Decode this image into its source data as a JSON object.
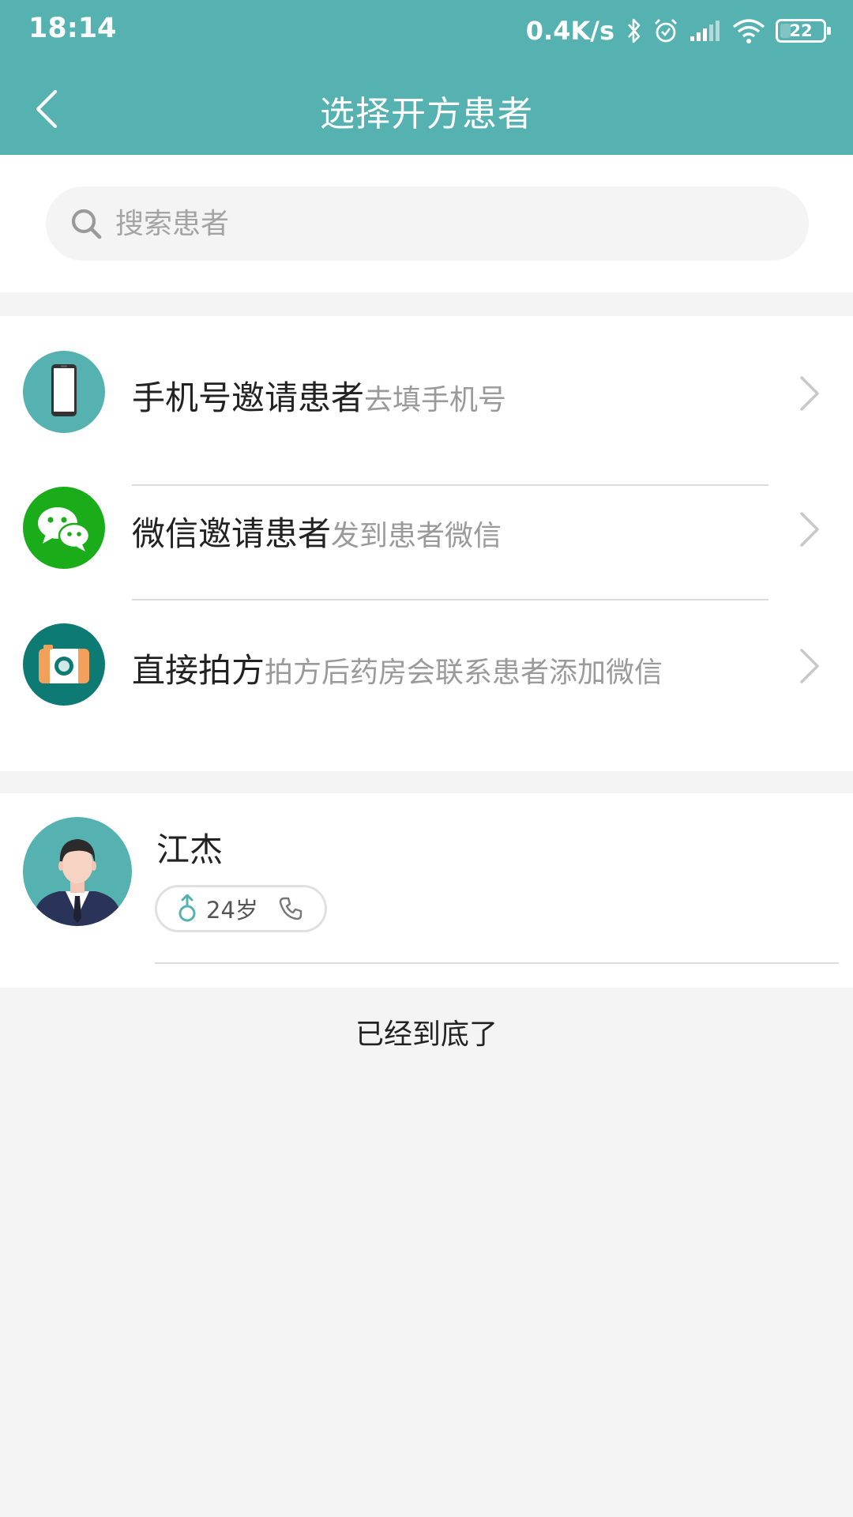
{
  "status_bar": {
    "time": "18:14",
    "network_speed": "0.4K/s",
    "battery_level": "22",
    "icons": [
      "bluetooth-icon",
      "alarm-icon",
      "signal-icon",
      "wifi-icon",
      "battery-icon"
    ]
  },
  "header": {
    "title": "选择开方患者",
    "background_color": "#56b2b1"
  },
  "search": {
    "placeholder": "搜索患者"
  },
  "invite_options": [
    {
      "label": "手机号邀请患者",
      "sub": "去填手机号",
      "icon": "phone-device-icon",
      "icon_color": "#56b2b1"
    },
    {
      "label": "微信邀请患者",
      "sub": "发到患者微信",
      "icon": "wechat-icon",
      "icon_color": "#1aad19"
    },
    {
      "label": "直接拍方",
      "sub": "拍方后药房会联系患者添加微信",
      "icon": "camera-icon",
      "icon_color": "#0e7a74"
    }
  ],
  "patients": [
    {
      "name": "江杰",
      "age": "24岁",
      "gender": "male",
      "icon": "male-gender-icon"
    }
  ],
  "footer": {
    "end_text": "已经到底了"
  }
}
